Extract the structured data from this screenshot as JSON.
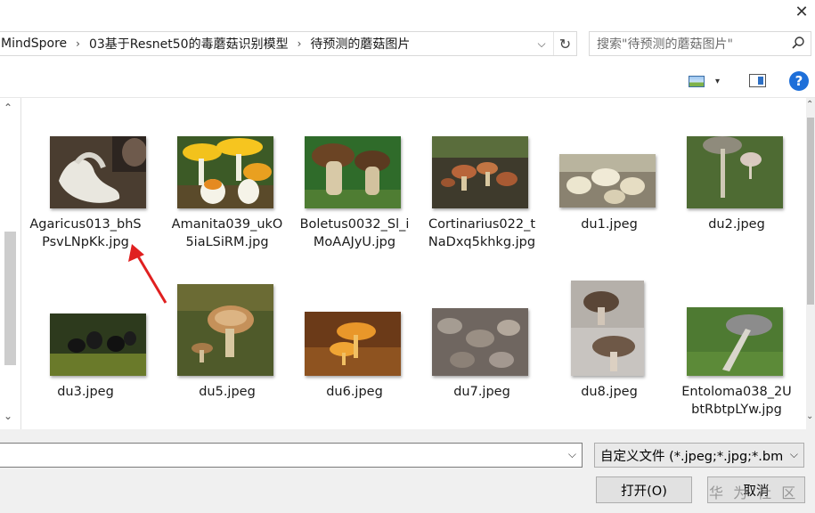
{
  "window": {
    "close_glyph": "✕"
  },
  "address": {
    "crumbs": [
      "MindSpore",
      "03基于Resnet50的毒蘑菇识别模型",
      "待预测的蘑菇图片"
    ],
    "separator": "›",
    "dropdown_glyph": "⌵",
    "refresh_glyph": "↻"
  },
  "search": {
    "placeholder": "搜索\"待预测的蘑菇图片\"",
    "icon": "search-icon"
  },
  "toolbar": {
    "view_icon": "picture-view-icon",
    "caret": "▾",
    "preview_icon": "preview-pane-icon",
    "help_label": "?"
  },
  "nav": {
    "up": "⌃",
    "down": "⌄"
  },
  "files": [
    {
      "label": "Agaricus013_bhSPsvLNpKk.jpg"
    },
    {
      "label": "Amanita039_ukO5iaLSiRM.jpg"
    },
    {
      "label": "Boletus0032_Sl_iMoAAJyU.jpg"
    },
    {
      "label": "Cortinarius022_tNaDxq5khkg.jpg"
    },
    {
      "label": "du1.jpeg"
    },
    {
      "label": "du2.jpeg"
    },
    {
      "label": "du3.jpeg"
    },
    {
      "label": "du5.jpeg"
    },
    {
      "label": "du6.jpeg"
    },
    {
      "label": "du7.jpeg"
    },
    {
      "label": "du8.jpeg"
    },
    {
      "label": "Entoloma038_2UbtRbtpLYw.jpg"
    }
  ],
  "bottom": {
    "filename_value": "",
    "dropdown_glyph": "⌵",
    "filetype": "自定义文件 (*.jpeg;*.jpg;*.bm",
    "open_label": "打开(O)",
    "cancel_label": "取消",
    "watermark": "华 为 社 区"
  },
  "colors": {
    "accent": "#1e6fd9",
    "arrow": "#e02020"
  }
}
